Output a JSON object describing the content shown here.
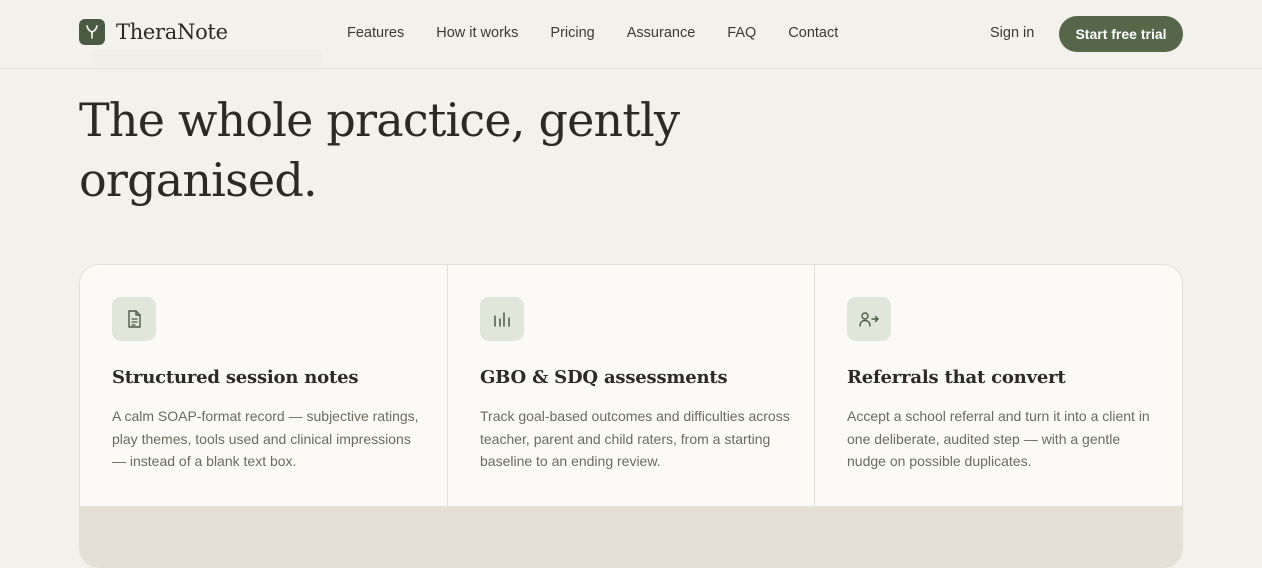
{
  "brand": {
    "name": "TheraNote",
    "logo_icon": "leaf-y-icon"
  },
  "nav": {
    "links": [
      {
        "label": "Features"
      },
      {
        "label": "How it works"
      },
      {
        "label": "Pricing"
      },
      {
        "label": "Assurance"
      },
      {
        "label": "FAQ"
      },
      {
        "label": "Contact"
      }
    ],
    "signin_label": "Sign in",
    "cta_label": "Start free trial"
  },
  "hero": {
    "title_line1": "The whole practice, gently",
    "title_line2": "organised."
  },
  "features": [
    {
      "icon": "document-icon",
      "title": "Structured session notes",
      "description": "A calm SOAP-format record — subjective ratings, play themes, tools used and clinical impressions — instead of a blank text box."
    },
    {
      "icon": "bar-chart-icon",
      "title": "GBO & SDQ assessments",
      "description": "Track goal-based outcomes and difficulties across teacher, parent and child raters, from a starting baseline to an ending review."
    },
    {
      "icon": "user-arrow-icon",
      "title": "Referrals that convert",
      "description": "Accept a school referral and turn it into a client in one deliberate, audited step — with a gentle nudge on possible duplicates."
    }
  ],
  "colors": {
    "background": "#f3f1ec",
    "accent": "#556649",
    "icon_tile": "#e1e6da",
    "card": "#fbfaf7",
    "lower_panel": "#e4e0d6"
  }
}
